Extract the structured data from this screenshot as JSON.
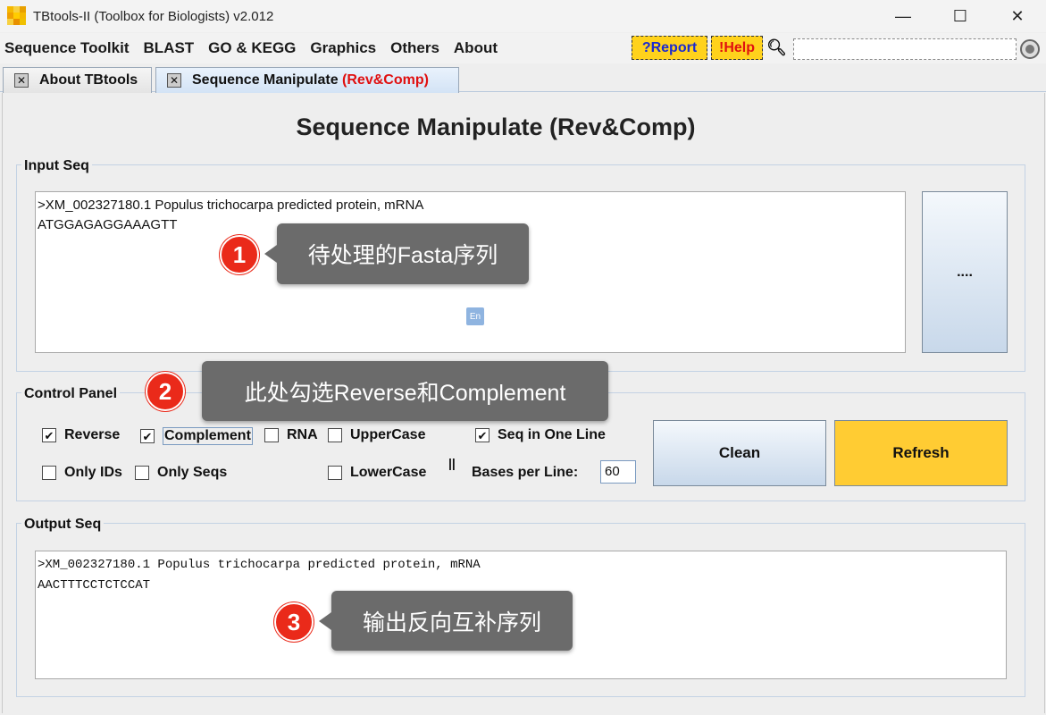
{
  "window": {
    "title": "TBtools-II (Toolbox for Biologists) v2.012",
    "minimize": "—",
    "maximize": "☐",
    "close": "✕"
  },
  "menu": {
    "items": [
      "Sequence Toolkit",
      "BLAST",
      "GO & KEGG",
      "Graphics",
      "Others",
      "About"
    ],
    "report": "?Report",
    "help": "!Help",
    "search_icon": "search-icon"
  },
  "tabs": [
    {
      "label": "About TBtools",
      "suffix": ""
    },
    {
      "label": "Sequence Manipulate ",
      "suffix": "(Rev&Comp)"
    }
  ],
  "page_title": "Sequence Manipulate (Rev&Comp)",
  "input": {
    "label": "Input Seq",
    "lines": [
      ">XM_002327180.1 Populus trichocarpa predicted protein, mRNA",
      "ATGGAGAGGAAAGTT"
    ],
    "browse_label": "...."
  },
  "control": {
    "label": "Control Panel",
    "reverse": {
      "label": "Reverse",
      "checked": true
    },
    "complement": {
      "label": "Complement",
      "checked": true
    },
    "rna": {
      "label": "RNA",
      "checked": false
    },
    "uppercase": {
      "label": "UpperCase",
      "checked": false
    },
    "seq_one_line": {
      "label": "Seq in One Line",
      "checked": true
    },
    "only_ids": {
      "label": "Only IDs",
      "checked": false
    },
    "only_seqs": {
      "label": "Only Seqs",
      "checked": false
    },
    "lowercase": {
      "label": "LowerCase",
      "checked": false
    },
    "separator": "||",
    "bases_per_line_label": "Bases per Line:",
    "bases_per_line_value": "60",
    "clean_label": "Clean",
    "refresh_label": "Refresh"
  },
  "output": {
    "label": "Output Seq",
    "lines": [
      ">XM_002327180.1 Populus trichocarpa predicted protein, mRNA",
      "AACTTTCCTCTCCAT"
    ]
  },
  "annotations": [
    {
      "number": "1",
      "text": "待处理的Fasta序列"
    },
    {
      "number": "2",
      "text": "此处勾选Reverse和Complement"
    },
    {
      "number": "3",
      "text": "输出反向互补序列"
    }
  ],
  "ime_label": "En",
  "colors": {
    "accent_yellow": "#ffcc33",
    "badge_yellow": "#ffd21c",
    "annotation_red": "#ea2a1a",
    "callout_gray": "#6b6b6b"
  }
}
